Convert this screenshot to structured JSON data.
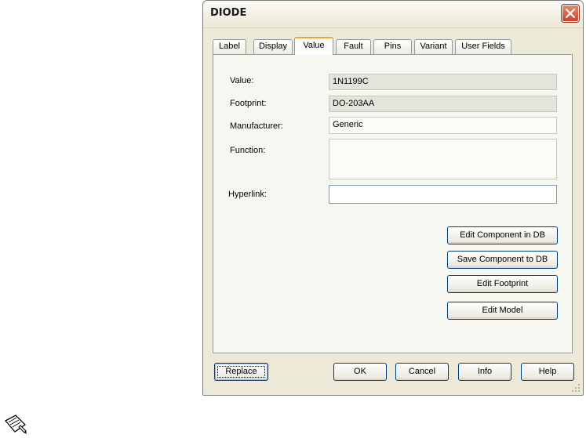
{
  "window": {
    "title": "DIODE"
  },
  "tabs": [
    {
      "label": "Label"
    },
    {
      "label": "Display"
    },
    {
      "label": "Value",
      "active": true
    },
    {
      "label": "Fault"
    },
    {
      "label": "Pins"
    },
    {
      "label": "Variant"
    },
    {
      "label": "User Fields"
    }
  ],
  "form": {
    "value": {
      "label": "Value:",
      "value": "1N1199C"
    },
    "footprint": {
      "label": "Footprint:",
      "value": "DO-203AA"
    },
    "manufacturer": {
      "label": "Manufacturer:",
      "value": "Generic"
    },
    "function": {
      "label": "Function:",
      "value": ""
    },
    "hyperlink": {
      "label": "Hyperlink:",
      "value": ""
    }
  },
  "actions": {
    "edit_component_db": "Edit Component in DB",
    "save_component_db": "Save Component to DB",
    "edit_footprint": "Edit Footprint",
    "edit_model": "Edit Model"
  },
  "footer": {
    "replace": "Replace",
    "ok": "OK",
    "cancel": "Cancel",
    "info": "Info",
    "help": "Help"
  },
  "icons": {
    "close": "close-icon",
    "note": "note-icon",
    "grip": "resize-grip-icon"
  },
  "colors": {
    "close_button": "#c8452a",
    "active_tab_accent": "#f0a53a",
    "dialog_bg": "#ece9d8"
  }
}
